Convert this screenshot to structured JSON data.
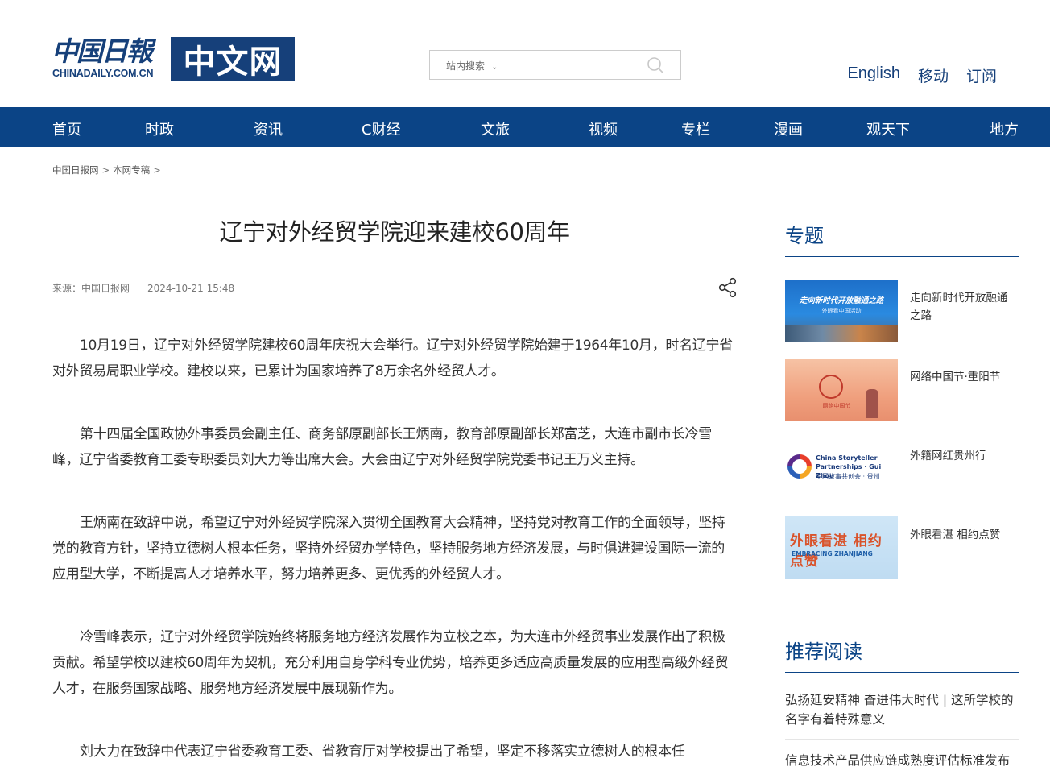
{
  "logo": {
    "cn": "中国日報",
    "en": "CHINADAILY.COM.CN",
    "box": "中文网"
  },
  "search": {
    "type_label": "站内搜索",
    "placeholder": ""
  },
  "top_links": [
    "English",
    "移动",
    "订阅"
  ],
  "nav": [
    "首页",
    "时政",
    "资讯",
    "C财经",
    "文旅",
    "视频",
    "专栏",
    "漫画",
    "观天下",
    "地方"
  ],
  "breadcrumb": [
    "中国日报网",
    "本网专稿"
  ],
  "article": {
    "title": "辽宁对外经贸学院迎来建校60周年",
    "source": "来源：中国日报网",
    "date": "2024-10-21 15:48",
    "paragraphs": [
      "10月19日，辽宁对外经贸学院建校60周年庆祝大会举行。辽宁对外经贸学院始建于1964年10月，时名辽宁省对外贸易局职业学校。建校以来，已累计为国家培养了8万余名外经贸人才。",
      "第十四届全国政协外事委员会副主任、商务部原副部长王炳南，教育部原副部长郑富芝，大连市副市长冷雪峰，辽宁省委教育工委专职委员刘大力等出席大会。大会由辽宁对外经贸学院党委书记王万义主持。",
      "王炳南在致辞中说，希望辽宁对外经贸学院深入贯彻全国教育大会精神，坚持党对教育工作的全面领导，坚持党的教育方针，坚持立德树人根本任务，坚持外经贸办学特色，坚持服务地方经济发展，与时俱进建设国际一流的应用型大学，不断提高人才培养水平，努力培养更多、更优秀的外经贸人才。",
      "冷雪峰表示，辽宁对外经贸学院始终将服务地方经济发展作为立校之本，为大连市外经贸事业发展作出了积极贡献。希望学校以建校60周年为契机，充分利用自身学科专业优势，培养更多适应高质量发展的应用型高级外经贸人才，在服务国家战略、服务地方经济发展中展现新作为。",
      "刘大力在致辞中代表辽宁省委教育工委、省教育厅对学校提出了希望，坚定不移落实立德树人的根本任"
    ]
  },
  "sidebar": {
    "topics_title": "专题",
    "topics": [
      {
        "title": "走向新时代开放融通之路",
        "thumb_text": "走向新时代开放融通之路",
        "thumb_sub": "外眼看中国活动"
      },
      {
        "title": "网络中国节·重阳节",
        "thumb_text": "网络中国节"
      },
      {
        "title": "外籍网红贵州行",
        "thumb_text": "China Storyteller Partnerships · Gui Zhou",
        "thumb_sub": "中国故事共创会 · 贵州"
      },
      {
        "title": "外眼看湛 相约点赞",
        "thumb_text": "外眼看湛 相约点赞",
        "thumb_sub": "EMBRACING ZHANJIANG"
      }
    ],
    "recommend_title": "推荐阅读",
    "recommend": [
      "弘扬延安精神 奋进伟大时代 | 这所学校的名字有着特殊意义",
      "信息技术产品供应链成熟度评估标准发布"
    ]
  },
  "colors": {
    "brand": "#16407a",
    "nav_bg": "#0b4486"
  }
}
